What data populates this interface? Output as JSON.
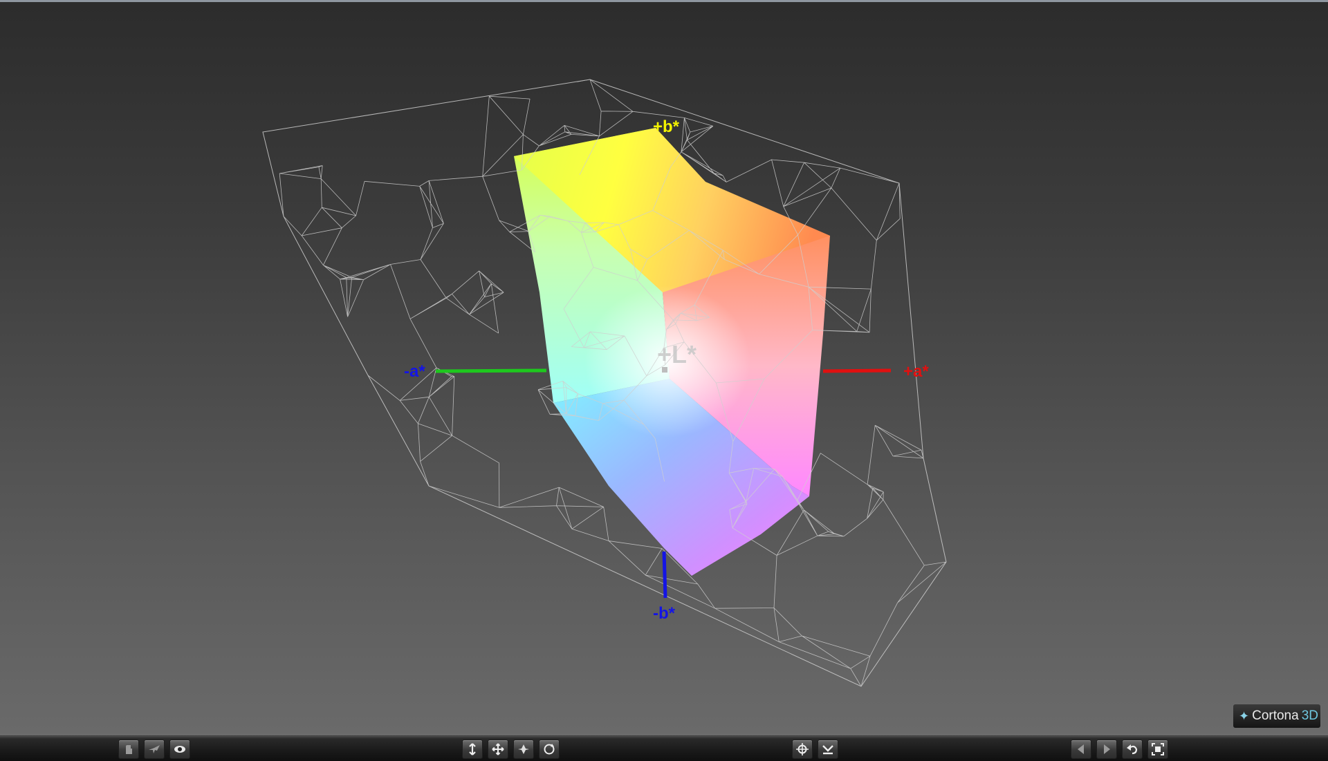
{
  "viewer": {
    "axes": {
      "plus_b": "+b*",
      "minus_b": "-b*",
      "plus_a": "+a*",
      "minus_a": "-a*",
      "plus_L": "+L*"
    },
    "axis_colors": {
      "a_plus": "#e01010",
      "a_minus": "#1ec81e",
      "b_plus": "#f4f400",
      "b_minus": "#1414e6",
      "L": "#c8c8c8"
    }
  },
  "logo": {
    "brand": "Cortona",
    "suffix": "3D"
  },
  "toolbar": {
    "left_group": [
      "pointer-icon",
      "fly-icon",
      "eye-icon"
    ],
    "center_group": [
      "walk-icon",
      "pan-icon",
      "plane-icon",
      "rotate-icon"
    ],
    "mid_group": [
      "target-icon",
      "align-icon"
    ],
    "right_group": [
      "previous-icon",
      "next-icon",
      "undo-icon",
      "fit-icon"
    ]
  }
}
